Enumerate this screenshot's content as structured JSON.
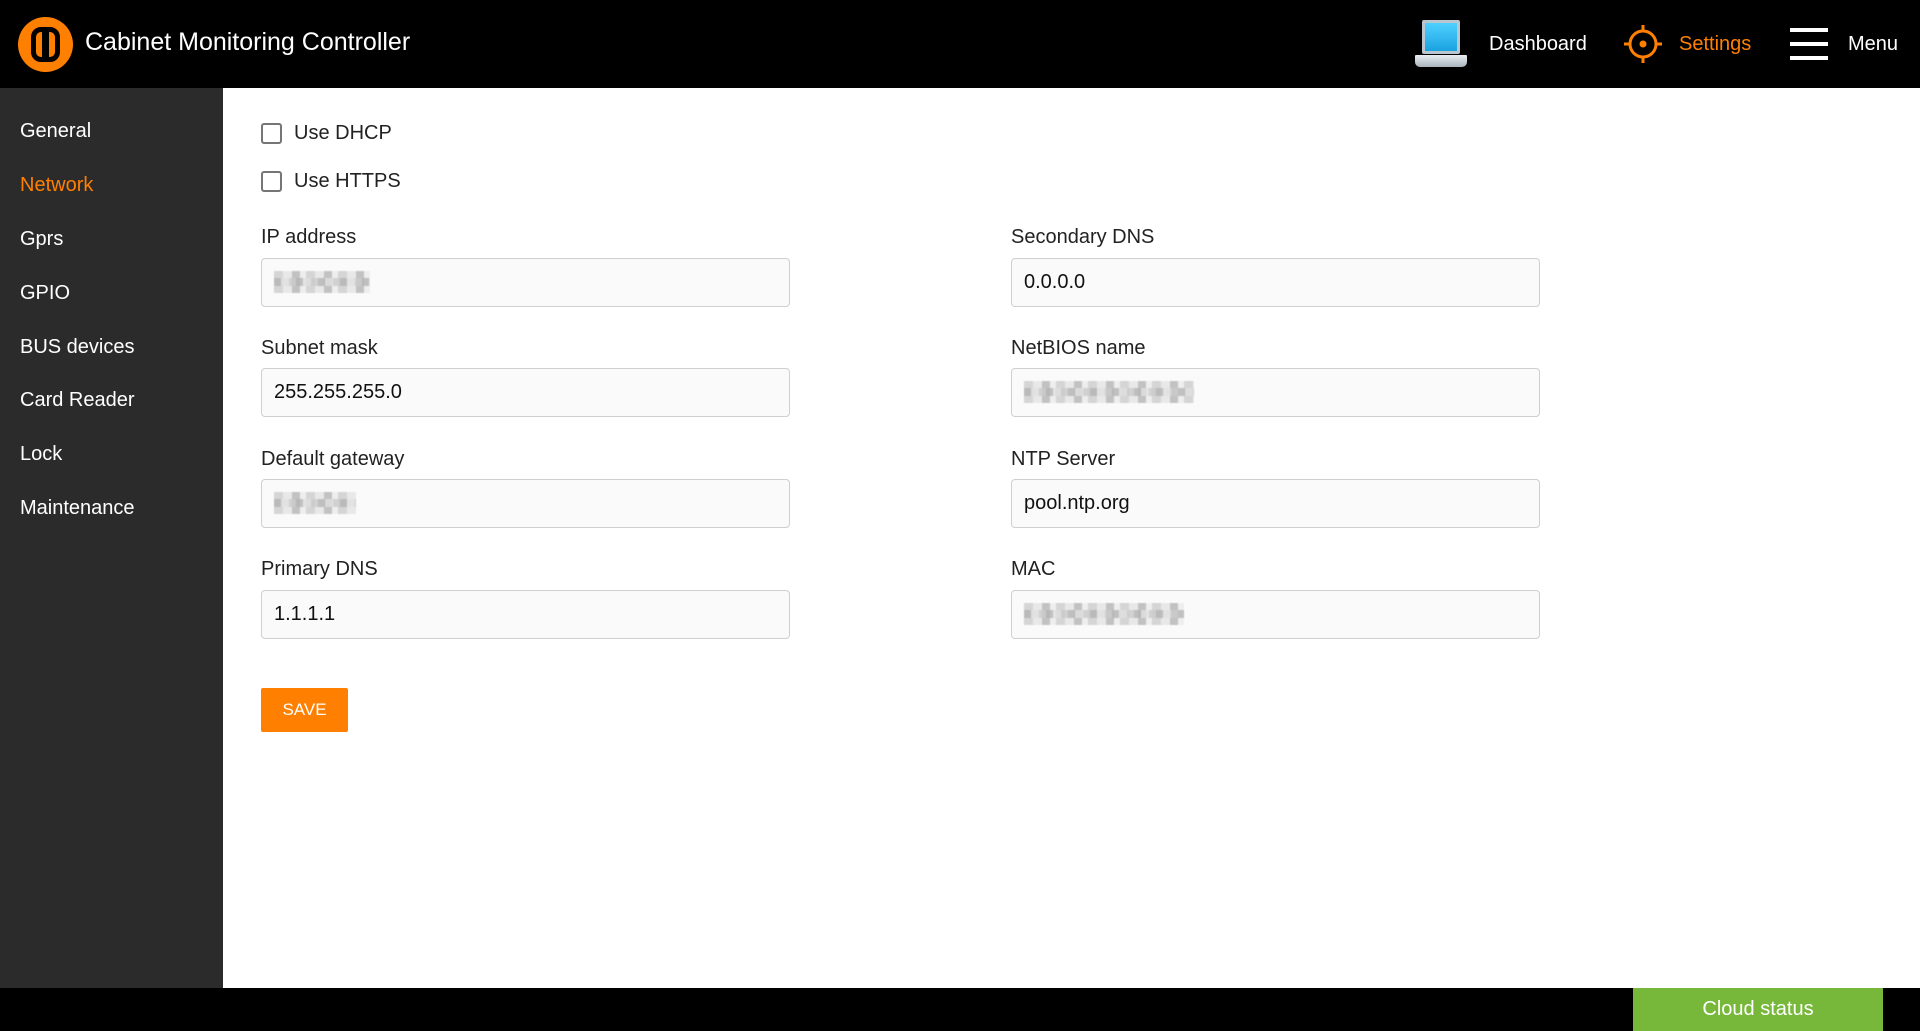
{
  "header": {
    "app_title": "Cabinet Monitoring Controller",
    "logo_icon": "orange-circle-logo-icon",
    "nav": {
      "dashboard": {
        "label": "Dashboard",
        "icon": "laptop-icon"
      },
      "settings": {
        "label": "Settings",
        "icon": "gear-icon",
        "active": true,
        "color": "#ff7f00"
      },
      "menu": {
        "label": "Menu",
        "icon": "hamburger-icon"
      }
    }
  },
  "sidebar": {
    "items": [
      {
        "label": "General"
      },
      {
        "label": "Network",
        "active": true
      },
      {
        "label": "Gprs"
      },
      {
        "label": "GPIO"
      },
      {
        "label": "BUS devices"
      },
      {
        "label": "Card Reader"
      },
      {
        "label": "Lock"
      },
      {
        "label": "Maintenance"
      }
    ],
    "active_color": "#ff7f00"
  },
  "form": {
    "use_dhcp": {
      "label": "Use DHCP",
      "checked": false
    },
    "use_https": {
      "label": "Use HTTPS",
      "checked": false
    },
    "ip_address": {
      "label": "IP address",
      "value": "",
      "masked": true
    },
    "subnet_mask": {
      "label": "Subnet mask",
      "value": "255.255.255.0"
    },
    "default_gateway": {
      "label": "Default gateway",
      "value": "",
      "masked": true
    },
    "primary_dns": {
      "label": "Primary DNS",
      "value": "1.1.1.1"
    },
    "secondary_dns": {
      "label": "Secondary DNS",
      "value": "0.0.0.0"
    },
    "netbios_name": {
      "label": "NetBIOS name",
      "value": "",
      "masked": true
    },
    "ntp_server": {
      "label": "NTP Server",
      "value": "pool.ntp.org"
    },
    "mac": {
      "label": "MAC",
      "value": "",
      "masked": true
    },
    "save_label": "SAVE"
  },
  "footer": {
    "cloud_status_label": "Cloud status",
    "cloud_status_color": "#77b83a"
  },
  "colors": {
    "accent": "#ff7f00",
    "header_bg": "#000000",
    "sidebar_bg": "#2b2b2b"
  }
}
